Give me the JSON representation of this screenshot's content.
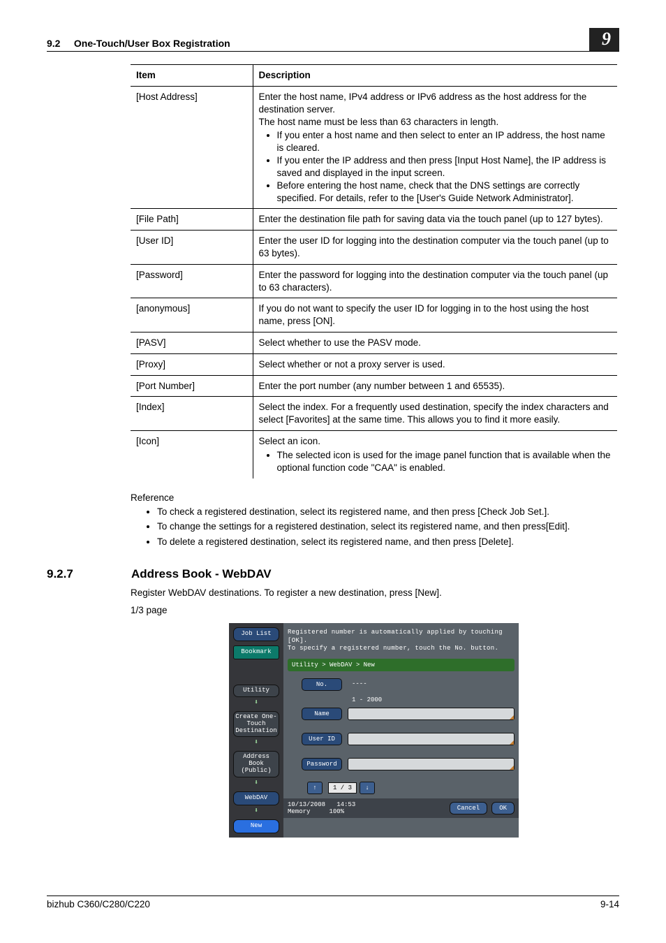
{
  "header": {
    "section_num": "9.2",
    "section_title": "One-Touch/User Box Registration",
    "chapter_num": "9"
  },
  "table": {
    "head_item": "Item",
    "head_desc": "Description",
    "rows": [
      {
        "item": "[Host Address]",
        "desc_intro": "Enter the host name, IPv4 address or IPv6 address as the host address for the destination server.\nThe host name must be less than 63 characters in length.",
        "bullets": [
          "If you enter a host name and then select to enter an IP address, the host name is cleared.",
          "If you enter the IP address and then press [Input Host Name], the IP address is saved and displayed in the input screen.",
          "Before entering the host name, check that the DNS settings are correctly specified. For details, refer to the [User's Guide Network Administrator]."
        ]
      },
      {
        "item": "[File Path]",
        "desc": "Enter the destination file path for saving data via the touch panel (up to 127 bytes)."
      },
      {
        "item": "[User ID]",
        "desc": "Enter the user ID for logging into the destination computer via the touch panel (up to 63 bytes)."
      },
      {
        "item": "[Password]",
        "desc": "Enter the password for logging into the destination computer via the touch panel (up to 63 characters)."
      },
      {
        "item": "[anonymous]",
        "desc": "If you do not want to specify the user ID for logging in to the host using the host name, press [ON]."
      },
      {
        "item": "[PASV]",
        "desc": "Select whether to use the PASV mode."
      },
      {
        "item": "[Proxy]",
        "desc": "Select whether or not a proxy server is used."
      },
      {
        "item": "[Port Number]",
        "desc": "Enter the port number (any number between 1 and 65535)."
      },
      {
        "item": "[Index]",
        "desc": "Select the index. For a frequently used destination, specify the index characters and select [Favorites] at the same time. This allows you to find it more easily."
      },
      {
        "item": "[Icon]",
        "desc_intro": "Select an icon.",
        "bullets": [
          "The selected icon is used for the image panel function that is available when the optional function code \"CAA\" is enabled."
        ]
      }
    ]
  },
  "reference": {
    "title": "Reference",
    "items": [
      "To check a registered destination, select its registered name, and then press [Check Job Set.].",
      "To change the settings for a registered destination, select its registered name, and then press[Edit].",
      "To delete a registered destination, select its registered name, and then press [Delete]."
    ]
  },
  "section": {
    "num": "9.2.7",
    "title": "Address Book - WebDAV",
    "para": "Register WebDAV destinations. To register a new destination, press [New].",
    "page_note": "1/3 page"
  },
  "screen": {
    "joblist": "Job List",
    "bookmark": "Bookmark",
    "hint1": "Registered number is automatically applied by touching [OK].",
    "hint2": "To specify a registered number, touch the No. button.",
    "breadcrumb": "Utility > WebDAV > New",
    "side": [
      "Utility",
      "Create One-Touch Destination",
      "Address Book (Public)",
      "WebDAV",
      "New"
    ],
    "labels": {
      "no": "No.",
      "name": "Name",
      "user_id": "User ID",
      "password": "Password"
    },
    "no_value": "----",
    "no_range": "1 - 2000",
    "pager": "1 / 3",
    "date": "10/13/2008",
    "time": "14:53",
    "mem_label": "Memory",
    "mem_value": "100%",
    "cancel": "Cancel",
    "ok": "OK"
  },
  "footer": {
    "left": "bizhub C360/C280/C220",
    "right": "9-14"
  }
}
